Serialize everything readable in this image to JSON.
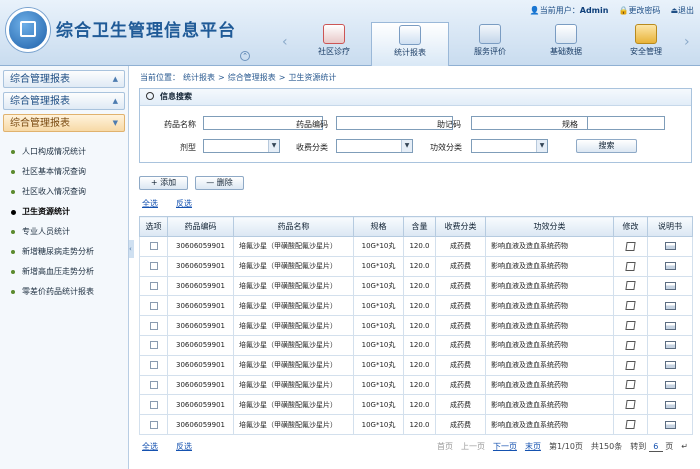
{
  "app": {
    "title": "综合卫生管理信息平台"
  },
  "userbar": {
    "user_label": "当前用户：",
    "user_name": "Admin",
    "change_password": "更改密码",
    "logout": "退出"
  },
  "nav": {
    "items": [
      "社区诊疗",
      "统计报表",
      "服务评价",
      "基础数据",
      "安全管理"
    ],
    "active": "统计报表"
  },
  "sidebar": {
    "sections": [
      "综合管理报表",
      "综合管理报表",
      "综合管理报表"
    ],
    "items": [
      "人口构成情况统计",
      "社区基本情况查询",
      "社区收入情况查询",
      "卫生资源统计",
      "专业人员统计",
      "新增糖尿病走势分析",
      "新增高血压走势分析",
      "零差价药品统计报表"
    ],
    "active_item": "卫生资源统计"
  },
  "breadcrumb": {
    "prefix": "当前位置：",
    "items": [
      "统计报表",
      "综合管理报表",
      "卫生资源统计"
    ]
  },
  "search": {
    "title": "信息搜索",
    "labels": {
      "drug_name": "药品名称",
      "drug_code": "药品编码",
      "mnemonic": "助记码",
      "spec": "规格",
      "dosage": "剂型",
      "fee_type": "收费分类",
      "effect_type": "功效分类"
    },
    "values": {
      "drug_name": "",
      "drug_code": "",
      "mnemonic": "",
      "spec": "",
      "dosage": "",
      "fee_type": "",
      "effect_type": ""
    },
    "button": "搜索"
  },
  "toolbar": {
    "add": "+ 添加",
    "delete": "— 删除",
    "select_all": "全选",
    "invert": "反选"
  },
  "table": {
    "headers": [
      "选项",
      "药品编码",
      "药品名称",
      "规格",
      "含量",
      "收费分类",
      "功效分类",
      "修改",
      "说明书"
    ],
    "rows": [
      [
        "30606059901",
        "培氟沙星（甲磺酸配氟沙星片）",
        "10G*10丸",
        "120.0",
        "成药费",
        "影响血液及造血系统药物"
      ],
      [
        "30606059901",
        "培氟沙星（甲磺酸配氟沙星片）",
        "10G*10丸",
        "120.0",
        "成药费",
        "影响血液及造血系统药物"
      ],
      [
        "30606059901",
        "培氟沙星（甲磺酸配氟沙星片）",
        "10G*10丸",
        "120.0",
        "成药费",
        "影响血液及造血系统药物"
      ],
      [
        "30606059901",
        "培氟沙星（甲磺酸配氟沙星片）",
        "10G*10丸",
        "120.0",
        "成药费",
        "影响血液及造血系统药物"
      ],
      [
        "30606059901",
        "培氟沙星（甲磺酸配氟沙星片）",
        "10G*10丸",
        "120.0",
        "成药费",
        "影响血液及造血系统药物"
      ],
      [
        "30606059901",
        "培氟沙星（甲磺酸配氟沙星片）",
        "10G*10丸",
        "120.0",
        "成药费",
        "影响血液及造血系统药物"
      ],
      [
        "30606059901",
        "培氟沙星（甲磺酸配氟沙星片）",
        "10G*10丸",
        "120.0",
        "成药费",
        "影响血液及造血系统药物"
      ],
      [
        "30606059901",
        "培氟沙星（甲磺酸配氟沙星片）",
        "10G*10丸",
        "120.0",
        "成药费",
        "影响血液及造血系统药物"
      ],
      [
        "30606059901",
        "培氟沙星（甲磺酸配氟沙星片）",
        "10G*10丸",
        "120.0",
        "成药费",
        "影响血液及造血系统药物"
      ],
      [
        "30606059901",
        "培氟沙星（甲磺酸配氟沙星片）",
        "10G*10丸",
        "120.0",
        "成药费",
        "影响血液及造血系统药物"
      ]
    ]
  },
  "footer": {
    "select_all": "全选",
    "invert": "反选"
  },
  "pager": {
    "first": "首页",
    "prev": "上一页",
    "next": "下一页",
    "last": "末页",
    "page_info": "第1/10页",
    "total": "共150条",
    "goto": "转到",
    "goto_value": "6",
    "page_suffix": "页"
  },
  "colors": {
    "brand": "#1f5a97",
    "link": "#1552b0",
    "active_section": "#f7d9a6"
  },
  "icons": [
    "first-aid-kit-icon",
    "clipboard-icon",
    "person-card-icon",
    "documents-icon",
    "padlock-icon"
  ]
}
